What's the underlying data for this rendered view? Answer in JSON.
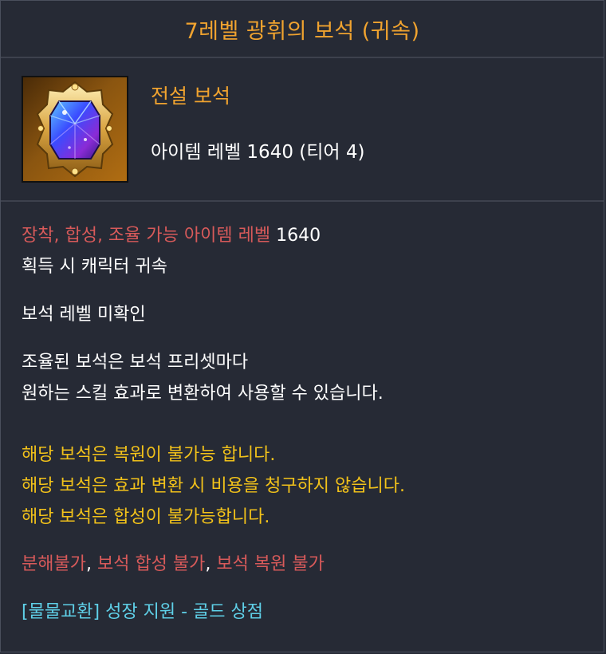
{
  "title": "7레벨 광휘의 보석 (귀속)",
  "summary": {
    "grade": "전설 보석",
    "item_level": "아이템 레벨 1640 (티어 4)"
  },
  "icon": "jewel-gem-icon",
  "colors": {
    "title": "#f0a32f",
    "red": "#d85a5a",
    "yellow": "#f2c21a",
    "cyan": "#5fd0e8",
    "background": "#262a35"
  },
  "details": {
    "equip_label": "장착, 합성, 조율 가능 아이템 레벨",
    "equip_value": "1640",
    "bind": "획득 시 캐릭터 귀속",
    "gem_level_status": "보석 레벨 미확인",
    "desc_line1": "조율된 보석은 보석 프리셋마다",
    "desc_line2": "원하는 스킬 효과로 변환하여 사용할 수 있습니다.",
    "warn1": "해당 보석은 복원이 불가능 합니다.",
    "warn2": "해당 보석은 효과 변환 시 비용을 청구하지 않습니다.",
    "warn3": "해당 보석은 합성이 불가능합니다.",
    "restrict1": "분해불가",
    "restrict2": "보석 합성 불가",
    "restrict3": "보석 복원 불가",
    "separator": ", ",
    "source": "[물물교환] 성장 지원 - 골드 상점"
  }
}
